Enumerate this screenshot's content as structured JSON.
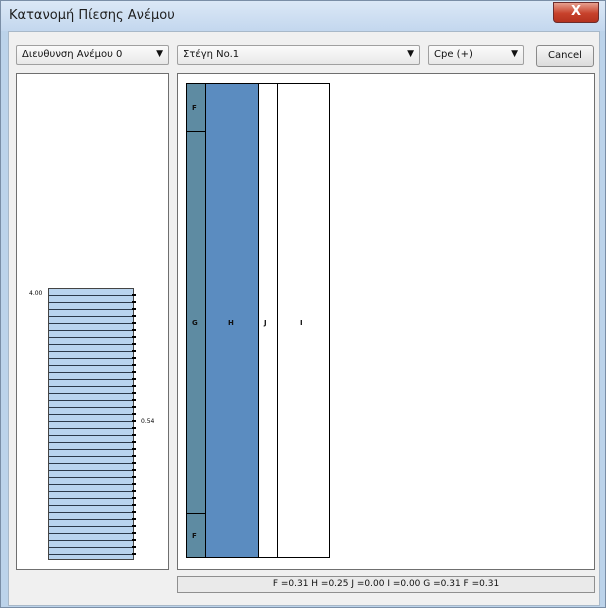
{
  "window": {
    "title": "Κατανομή Πίεσης Ανέμου",
    "close_label": "X"
  },
  "toolbar": {
    "wind_direction": {
      "value": "Διευθυνση Ανέμου 0",
      "arrow": "▼"
    },
    "roof": {
      "value": "Στέγη No.1",
      "arrow": "▼"
    },
    "cpe": {
      "value": "Cpe (+)",
      "arrow": "▼"
    },
    "cancel_label": "Cancel"
  },
  "profile": {
    "top_value": "4.00",
    "mid_value": "0.54"
  },
  "zones": {
    "f_top": "F",
    "g": "G",
    "h": "H",
    "j": "J",
    "i": "I",
    "f_bottom": "F"
  },
  "colors": {
    "zone_fg": "#5e8ba2",
    "zone_h": "#5b8cc0",
    "profile_fill": "#b9d4ee"
  },
  "status": {
    "text": "F =0.31 H =0.25 J =0.00 I =0.00 G =0.31 F =0.31"
  }
}
